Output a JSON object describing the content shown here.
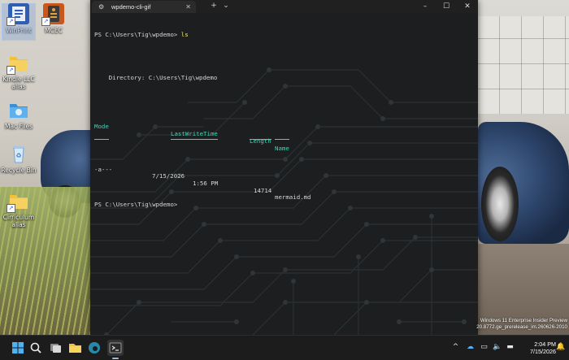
{
  "desktop": {
    "icons": [
      {
        "label": "WinPrint",
        "icon": "winprint-icon",
        "color": "#2f5fb3"
      },
      {
        "label": "MCEC",
        "icon": "mcec-icon",
        "color": "#c9561c"
      },
      {
        "label": "Kindle LLC alias",
        "icon": "folder-icon",
        "color": "#f2c13a"
      },
      {
        "label": "Mac Files",
        "icon": "folder-icon",
        "color": "#4aa3e6"
      },
      {
        "label": "Recycle Bin",
        "icon": "recycle-bin-icon",
        "color": "#cfe3f6"
      },
      {
        "label": "Cirriculum alias",
        "icon": "folder-icon",
        "color": "#f2c13a"
      }
    ]
  },
  "terminal": {
    "tab_title": "wpdemo-cli-gif",
    "new_tab": "+",
    "dropdown": "⌄",
    "minimize": "–",
    "maximize": "☐",
    "close": "✕",
    "tab_close": "✕",
    "lines": {
      "prompt1": "PS C:\\Users\\Tig\\wpdemo> ",
      "cmd1": "ls",
      "directory": "    Directory: C:\\Users\\Tig\\wpdemo",
      "prompt2": "PS C:\\Users\\Tig\\wpdemo>"
    },
    "listing": {
      "headers": {
        "mode": "Mode",
        "lastwrite": "LastWriteTime",
        "length": "Length",
        "name": "Name"
      },
      "rows": [
        {
          "mode": "-a---",
          "date": "7/15/2026",
          "time": "1:56 PM",
          "length": "14714",
          "name": "mermaid.md"
        }
      ]
    },
    "colors": {
      "header": "#3fd7b8",
      "command": "#f2e86d",
      "text": "#d6d6d6"
    }
  },
  "watermark": {
    "line1": "Windows 11 Enterprise Insider Preview",
    "line2": "20.8772.ge_prerelease_im.260626-2010"
  },
  "taskbar": {
    "tray_chevron": "^",
    "time": "2:04 PM",
    "date": "7/15/2026",
    "items": [
      "start-icon",
      "search-icon",
      "task-view-icon",
      "file-explorer-icon",
      "edge-icon",
      "terminal-icon"
    ]
  }
}
